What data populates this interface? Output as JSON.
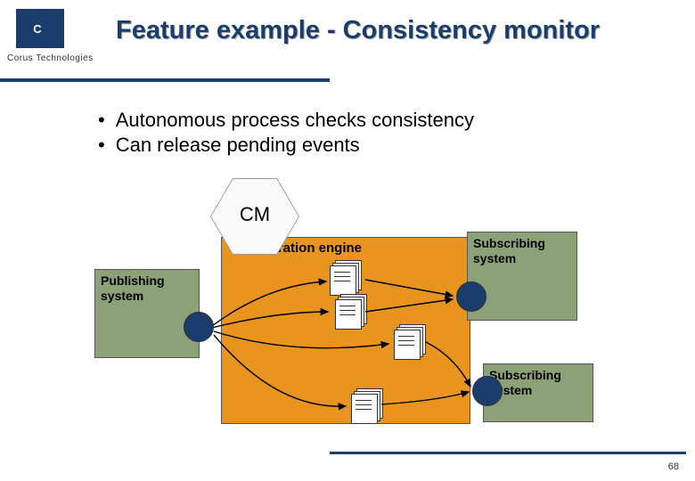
{
  "header": {
    "logo_letter": "C",
    "logo_subtitle": "Corus Technologies",
    "title": "Feature example - Consistency monitor"
  },
  "bullets": [
    "Autonomous process checks consistency",
    "Can release pending events"
  ],
  "diagram": {
    "cm_label": "CM",
    "engine_label": "Integration engine",
    "publishing_label": "Publishing\nsystem",
    "subscribing1_label": "Subscribing\nsystem",
    "subscribing2_label": "Subscribing\nsystem"
  },
  "page_number": "68",
  "colors": {
    "brand": "#1a3d6d",
    "engine": "#e8941f",
    "green": "#8ca178"
  }
}
